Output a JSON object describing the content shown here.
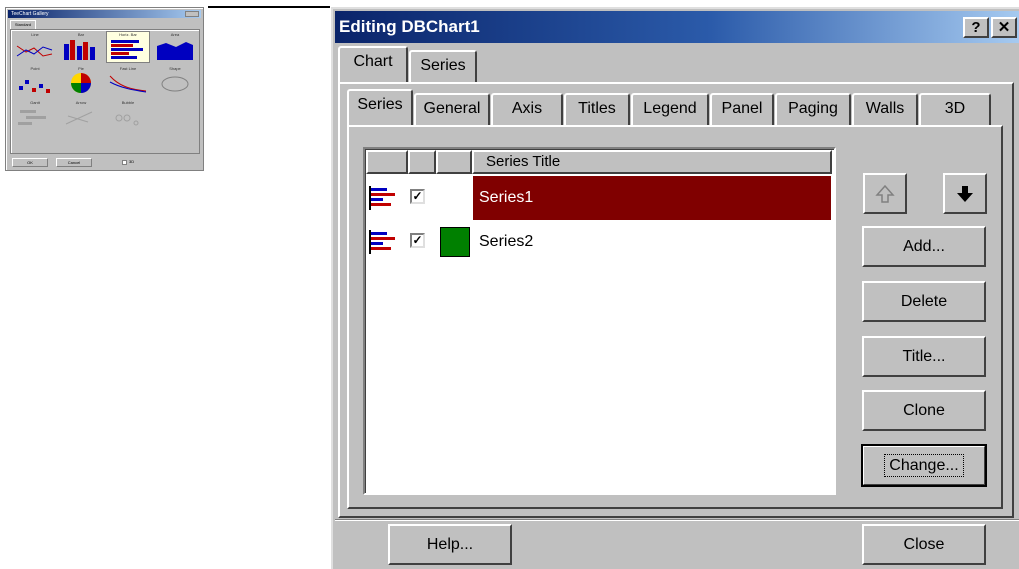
{
  "thumbnail": {
    "window_title": "TeeChart Gallery",
    "tab": "Standard",
    "items": [
      {
        "label": "Line"
      },
      {
        "label": "Bar"
      },
      {
        "label": "Horiz. Bar"
      },
      {
        "label": "Area"
      },
      {
        "label": "Point"
      },
      {
        "label": "Pie"
      },
      {
        "label": "Fast Line"
      },
      {
        "label": "Shape"
      },
      {
        "label": "Gantt"
      },
      {
        "label": "Arrow"
      },
      {
        "label": "Bubble"
      }
    ],
    "ok_label": "OK",
    "cancel_label": "Cancel",
    "check_label": "3D"
  },
  "dialog": {
    "title": "Editing DBChart1",
    "help_glyph": "?",
    "close_glyph": "✕",
    "outer_tabs": [
      {
        "label": "Chart"
      },
      {
        "label": "Series"
      }
    ],
    "inner_tabs": [
      {
        "label": "Series"
      },
      {
        "label": "General"
      },
      {
        "label": "Axis"
      },
      {
        "label": "Titles"
      },
      {
        "label": "Legend"
      },
      {
        "label": "Panel"
      },
      {
        "label": "Paging"
      },
      {
        "label": "Walls"
      },
      {
        "label": "3D"
      }
    ],
    "list_header": {
      "title": "Series Title"
    },
    "series": [
      {
        "title": "Series1",
        "checked": "☑",
        "check_glyph": "✓",
        "color": "",
        "selected": true
      },
      {
        "title": "Series2",
        "checked": "☑",
        "check_glyph": "✓",
        "color": "#008000",
        "selected": false
      }
    ],
    "buttons": {
      "add": "Add...",
      "delete": "Delete",
      "title": "Title...",
      "clone": "Clone",
      "change": "Change...",
      "help": "Help...",
      "close": "Close"
    },
    "colors": {
      "selection": "#800000",
      "series2": "#008000"
    }
  }
}
